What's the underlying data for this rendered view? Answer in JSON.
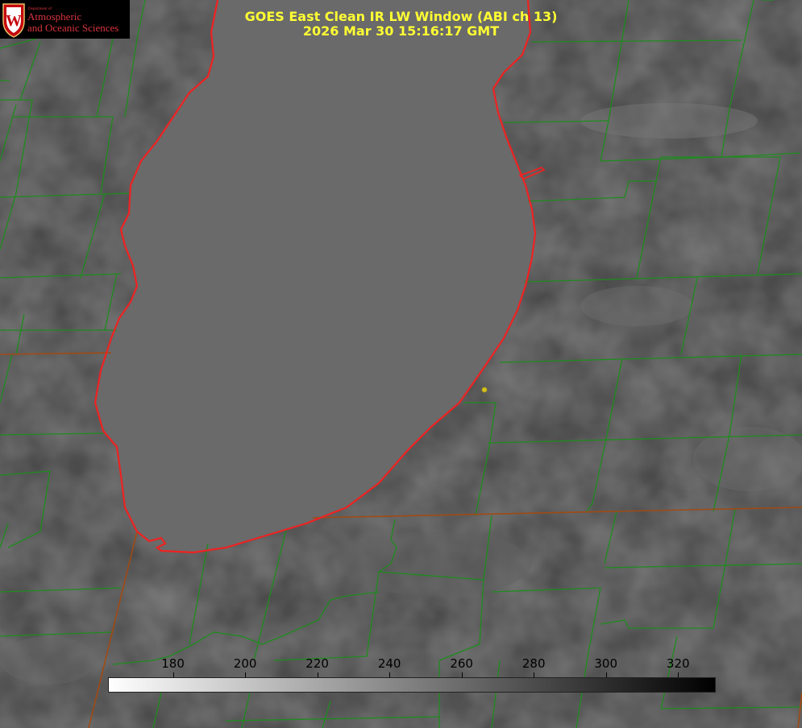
{
  "logo": {
    "dept_text": "Department of",
    "line1": "Atmospheric",
    "line2": "and Oceanic Sciences",
    "seal_letter": "W"
  },
  "title": {
    "line1": "GOES East Clean IR LW Window (ABI ch 13)",
    "line2": "2026 Mar 30 15:16:17 GMT"
  },
  "colorbar": {
    "min": 162,
    "max": 330,
    "ticks": [
      "180",
      "200",
      "220",
      "240",
      "260",
      "280",
      "300",
      "320"
    ]
  },
  "colors": {
    "county_lines": "#1e8c1e",
    "coastline": "#ee2222",
    "state_lines": "#a04a14",
    "title_text": "#ffff33",
    "marker": "#d4c020"
  }
}
